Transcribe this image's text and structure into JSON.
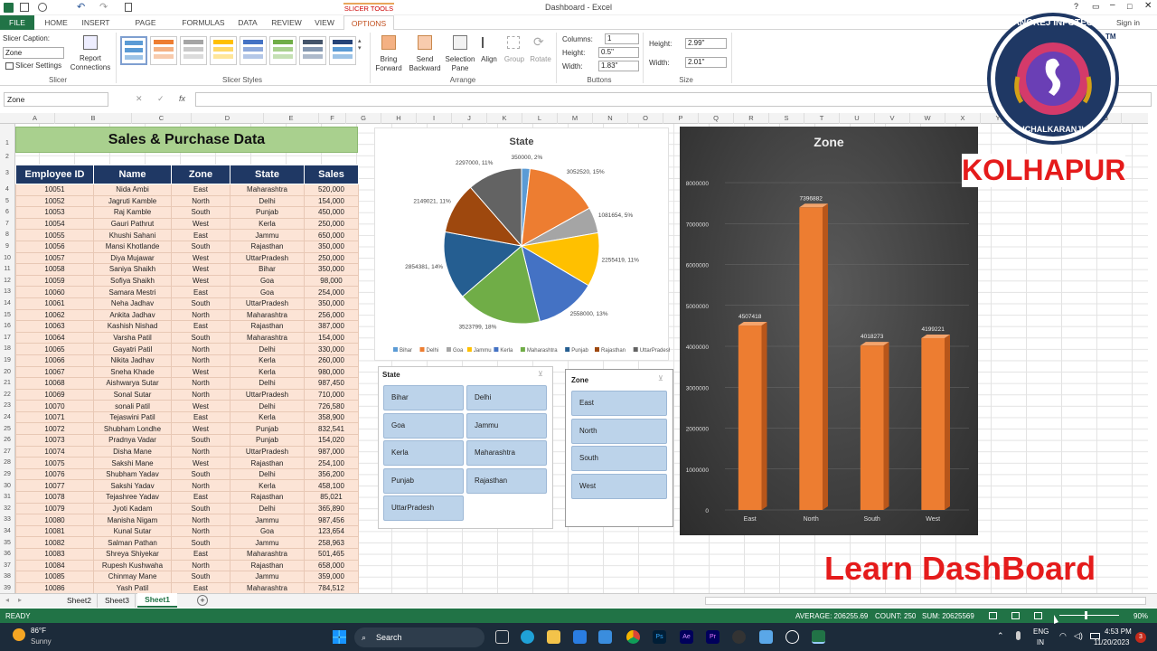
{
  "window": {
    "title": "Dashboard - Excel",
    "slicer_tools": "SLICER TOOLS",
    "sign_in": "Sign in"
  },
  "tabs": [
    "FILE",
    "HOME",
    "INSERT",
    "PAGE LAYOUT",
    "FORMULAS",
    "DATA",
    "REVIEW",
    "VIEW",
    "OPTIONS"
  ],
  "ribbon": {
    "slicer_caption_label": "Slicer Caption:",
    "slicer_caption_value": "Zone",
    "slicer_settings": "Slicer Settings",
    "report_connections": "Report Connections",
    "group_slicer": "Slicer",
    "group_styles": "Slicer Styles",
    "bring_forward": "Bring Forward",
    "send_backward": "Send Backward",
    "selection_pane": "Selection Pane",
    "align": "Align",
    "group": "Group",
    "rotate": "Rotate",
    "group_arrange": "Arrange",
    "columns_label": "Columns:",
    "columns_value": "1",
    "btn_height_label": "Height:",
    "btn_height_value": "0.5\"",
    "btn_width_label": "Width:",
    "btn_width_value": "1.83\"",
    "group_buttons": "Buttons",
    "size_height_label": "Height:",
    "size_height_value": "2.99\"",
    "size_width_label": "Width:",
    "size_width_value": "2.01\"",
    "group_size": "Size"
  },
  "name_box": "Zone",
  "columns": [
    "A",
    "B",
    "C",
    "D",
    "E",
    "F",
    "G",
    "H",
    "I",
    "J",
    "K",
    "L",
    "M",
    "N",
    "O",
    "P",
    "Q",
    "R",
    "S",
    "T",
    "U",
    "V",
    "W",
    "X",
    "Y",
    "Z",
    "AA",
    "AB"
  ],
  "rows": [
    "1",
    "2",
    "3",
    "4",
    "5",
    "6",
    "7",
    "8",
    "9",
    "10",
    "11",
    "12",
    "13",
    "14",
    "15",
    "16",
    "17",
    "18",
    "19",
    "20",
    "21",
    "22",
    "23",
    "24",
    "25",
    "26",
    "27",
    "28",
    "29",
    "30",
    "31",
    "32",
    "33",
    "34",
    "35",
    "36",
    "37",
    "38",
    "39"
  ],
  "sheet": {
    "banner": "Sales & Purchase Data",
    "headers": [
      "Employee ID",
      "Name",
      "Zone",
      "State",
      "Sales"
    ],
    "data": [
      [
        "10051",
        "Nida Ambi",
        "East",
        "Maharashtra",
        "520,000"
      ],
      [
        "10052",
        "Jagruti Kamble",
        "North",
        "Delhi",
        "154,000"
      ],
      [
        "10053",
        "Raj Kamble",
        "South",
        "Punjab",
        "450,000"
      ],
      [
        "10054",
        "Gauri Pathrut",
        "West",
        "Kerla",
        "250,000"
      ],
      [
        "10055",
        "Khushi Sahani",
        "East",
        "Jammu",
        "650,000"
      ],
      [
        "10056",
        "Mansi Khotlande",
        "South",
        "Rajasthan",
        "350,000"
      ],
      [
        "10057",
        "Diya Mujawar",
        "West",
        "UttarPradesh",
        "250,000"
      ],
      [
        "10058",
        "Saniya Shaikh",
        "West",
        "Bihar",
        "350,000"
      ],
      [
        "10059",
        "Sofiya Shaikh",
        "West",
        "Goa",
        "98,000"
      ],
      [
        "10060",
        "Samara Mestri",
        "East",
        "Goa",
        "254,000"
      ],
      [
        "10061",
        "Neha Jadhav",
        "South",
        "UttarPradesh",
        "350,000"
      ],
      [
        "10062",
        "Ankita Jadhav",
        "North",
        "Maharashtra",
        "256,000"
      ],
      [
        "10063",
        "Kashish Nishad",
        "East",
        "Rajasthan",
        "387,000"
      ],
      [
        "10064",
        "Varsha Patil",
        "South",
        "Maharashtra",
        "154,000"
      ],
      [
        "10065",
        "Gayatri Patil",
        "North",
        "Delhi",
        "330,000"
      ],
      [
        "10066",
        "Nikita Jadhav",
        "North",
        "Kerla",
        "260,000"
      ],
      [
        "10067",
        "Sneha Khade",
        "West",
        "Kerla",
        "980,000"
      ],
      [
        "10068",
        "Aishwarya Sutar",
        "North",
        "Delhi",
        "987,450"
      ],
      [
        "10069",
        "Sonal Sutar",
        "North",
        "UttarPradesh",
        "710,000"
      ],
      [
        "10070",
        "sonali Patil",
        "West",
        "Delhi",
        "726,580"
      ],
      [
        "10071",
        "Tejaswini Patil",
        "East",
        "Kerla",
        "358,900"
      ],
      [
        "10072",
        "Shubham Londhe",
        "West",
        "Punjab",
        "832,541"
      ],
      [
        "10073",
        "Pradnya Vadar",
        "South",
        "Punjab",
        "154,020"
      ],
      [
        "10074",
        "Disha Mane",
        "North",
        "UttarPradesh",
        "987,000"
      ],
      [
        "10075",
        "Sakshi Mane",
        "West",
        "Rajasthan",
        "254,100"
      ],
      [
        "10076",
        "Shubham Yadav",
        "South",
        "Delhi",
        "356,200"
      ],
      [
        "10077",
        "Sakshi Yadav",
        "North",
        "Kerla",
        "458,100"
      ],
      [
        "10078",
        "Tejashree Yadav",
        "East",
        "Rajasthan",
        "85,021"
      ],
      [
        "10079",
        "Jyoti Kadam",
        "South",
        "Delhi",
        "365,890"
      ],
      [
        "10080",
        "Manisha Nigam",
        "North",
        "Jammu",
        "987,456"
      ],
      [
        "10081",
        "Kunal Sutar",
        "North",
        "Goa",
        "123,654"
      ],
      [
        "10082",
        "Salman Pathan",
        "South",
        "Jammu",
        "258,963"
      ],
      [
        "10083",
        "Shreya Shiyekar",
        "East",
        "Maharashtra",
        "501,465"
      ],
      [
        "10084",
        "Rupesh Kushwaha",
        "North",
        "Rajasthan",
        "658,000"
      ],
      [
        "10085",
        "Chinmay Mane",
        "South",
        "Jammu",
        "359,000"
      ],
      [
        "10086",
        "Yash Patil",
        "East",
        "Maharashtra",
        "784,512"
      ]
    ]
  },
  "chart_data": [
    {
      "type": "pie",
      "title": "State",
      "categories": [
        "Bihar",
        "Delhi",
        "Goa",
        "Jammu",
        "Kerla",
        "Maharashtra",
        "Punjab",
        "Rajasthan",
        "UttarPradesh"
      ],
      "values": [
        350000,
        3052520,
        1081654,
        2255419,
        2558000,
        3523799,
        2854381,
        2149021,
        2297000
      ],
      "labels": [
        "350000, 2%",
        "3052520, 15%",
        "1081654, 5%",
        "2255419, 11%",
        "2558000, 13%",
        "3523799, 18%",
        "2854381, 14%",
        "2149021, 11%",
        "2297000, 11%"
      ],
      "colors": [
        "#5b9bd5",
        "#ed7d31",
        "#a5a5a5",
        "#ffc000",
        "#4472c4",
        "#70ad47",
        "#255e91",
        "#9e480e",
        "#636363"
      ]
    },
    {
      "type": "bar",
      "title": "Zone",
      "categories": [
        "East",
        "North",
        "South",
        "West"
      ],
      "values": [
        4507418,
        7396882,
        4018273,
        4199221
      ],
      "ylim": [
        0,
        8000000
      ],
      "yticks": [
        "0",
        "1000000",
        "2000000",
        "3000000",
        "4000000",
        "5000000",
        "6000000",
        "7000000",
        "8000000"
      ],
      "color": "#ed7d31"
    }
  ],
  "slicers": {
    "state_title": "State",
    "state_items": [
      "Bihar",
      "Delhi",
      "Goa",
      "Jammu",
      "Kerla",
      "Maharashtra",
      "Punjab",
      "Rajasthan",
      "UttarPradesh"
    ],
    "zone_title": "Zone",
    "zone_items": [
      "East",
      "North",
      "South",
      "West"
    ]
  },
  "overlay": {
    "logo_top": "RANGREJ INFOTECH",
    "logo_bottom": "ICHALKARANJI",
    "tm": "TM",
    "city": "KOLHAPUR",
    "caption": "Learn DashBoard"
  },
  "sheet_tabs": [
    "Sheet2",
    "Sheet3",
    "Sheet1"
  ],
  "status": {
    "ready": "READY",
    "average": "AVERAGE: 206255.69",
    "count": "COUNT: 250",
    "sum": "SUM: 20625569",
    "zoom": "90%"
  },
  "taskbar": {
    "temp": "86°F",
    "weather": "Sunny",
    "search": "Search",
    "lang1": "ENG",
    "lang2": "IN",
    "time": "4:53 PM",
    "date": "11/20/2023",
    "badge": "3"
  }
}
